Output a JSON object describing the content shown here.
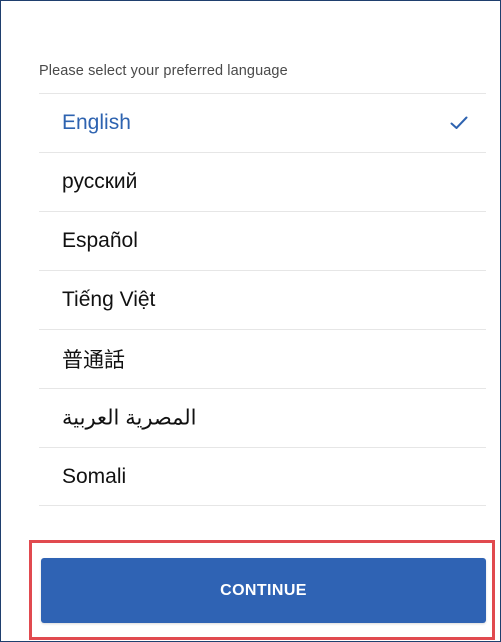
{
  "prompt": "Please select your preferred language",
  "languages": [
    {
      "label": "English",
      "selected": true
    },
    {
      "label": "русский",
      "selected": false
    },
    {
      "label": "Español",
      "selected": false
    },
    {
      "label": "Tiếng Việt",
      "selected": false
    },
    {
      "label": "普通話",
      "selected": false
    },
    {
      "label": "المصرية العربية",
      "selected": false
    },
    {
      "label": "Somali",
      "selected": false
    }
  ],
  "selected_icon": "checkmark-icon",
  "continue_label": "CONTINUE",
  "colors": {
    "accent": "#2f63b4",
    "selected_text": "#2e63b0",
    "highlight_border": "#e14a4f",
    "divider": "#e6e6e6"
  }
}
